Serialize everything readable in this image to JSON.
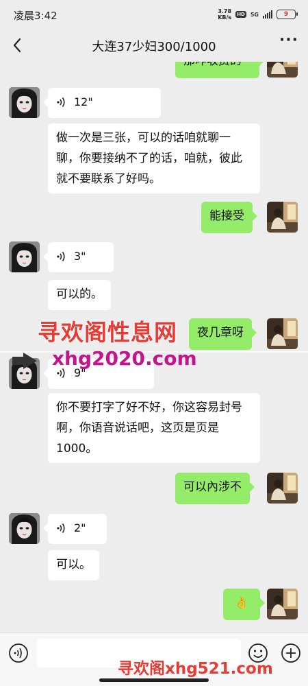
{
  "status_bar": {
    "time": "凌晨3:42",
    "net_speed_value": "3.78",
    "net_speed_unit": "KB/s",
    "hd_badge": "HD",
    "signal_label": "5G",
    "battery": "9"
  },
  "header": {
    "title": "大连37少妇300/1000",
    "back_icon": "chevron-left-icon",
    "more_icon": "more-dots-icon"
  },
  "messages": [
    {
      "from": "me",
      "type": "text",
      "text": "那咋收费的"
    },
    {
      "from": "other",
      "type": "voice",
      "duration": "12\""
    },
    {
      "from": "other",
      "type": "text",
      "text": "做一次是三张，可以的话咱就聊一聊，你要接纳不了的话，咱就，彼此就不要联系了好吗。"
    },
    {
      "from": "me",
      "type": "text",
      "text": "能接受"
    },
    {
      "from": "other",
      "type": "voice",
      "duration": "3\""
    },
    {
      "from": "other",
      "type": "text",
      "text": "可以的。"
    },
    {
      "from": "me",
      "type": "text",
      "text": "夜几章呀"
    },
    {
      "from": "other",
      "type": "voice",
      "duration": "9\""
    },
    {
      "from": "other",
      "type": "text",
      "text": "你不要打字了好不好，你这容易封号啊，你语音说话吧，这页是页是1000。"
    },
    {
      "from": "me",
      "type": "text",
      "text": "可以內涉不"
    },
    {
      "from": "other",
      "type": "voice",
      "duration": "2\""
    },
    {
      "from": "other",
      "type": "text",
      "text": "可以。"
    },
    {
      "from": "me",
      "type": "emoji",
      "text": "👌"
    }
  ],
  "watermarks": {
    "line1": "寻欢阁性息网",
    "line2": "xhg2020.com",
    "bottom": "寻欢阁xhg521.com"
  },
  "input_bar": {
    "voice_icon": "voice-mode-icon",
    "emoji_icon": "emoji-icon",
    "plus_icon": "plus-icon",
    "value": ""
  },
  "colors": {
    "background": "#ededed",
    "my_bubble": "#95ec69",
    "their_bubble": "#ffffff",
    "watermark_red": "#e93a34",
    "watermark_magenta": "#c4148c"
  }
}
